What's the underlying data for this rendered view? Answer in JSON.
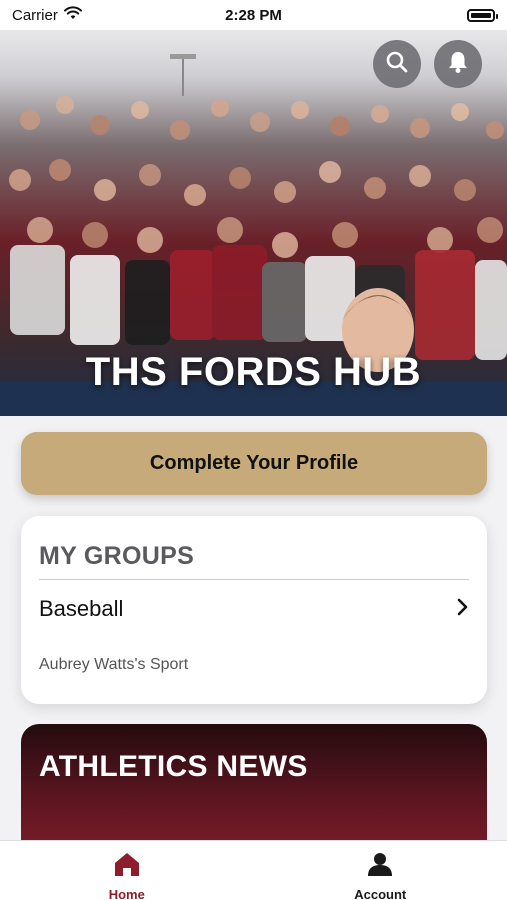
{
  "status_bar": {
    "carrier": "Carrier",
    "time": "2:28 PM"
  },
  "hero": {
    "title": "THS FORDS HUB",
    "search_icon": "search-icon",
    "notification_icon": "bell-icon"
  },
  "profile": {
    "button_label": "Complete Your Profile"
  },
  "groups": {
    "title": "MY GROUPS",
    "items": [
      {
        "name": "Baseball",
        "subtitle": "Aubrey Watts's Sport"
      }
    ]
  },
  "news": {
    "title": "ATHLETICS NEWS"
  },
  "tabs": [
    {
      "label": "Home",
      "icon": "home-icon",
      "active": true
    },
    {
      "label": "Account",
      "icon": "person-icon",
      "active": false
    }
  ],
  "colors": {
    "accent_gold": "#c6aa79",
    "maroon": "#7b1c2a",
    "active_tab": "#8b1d2c"
  }
}
